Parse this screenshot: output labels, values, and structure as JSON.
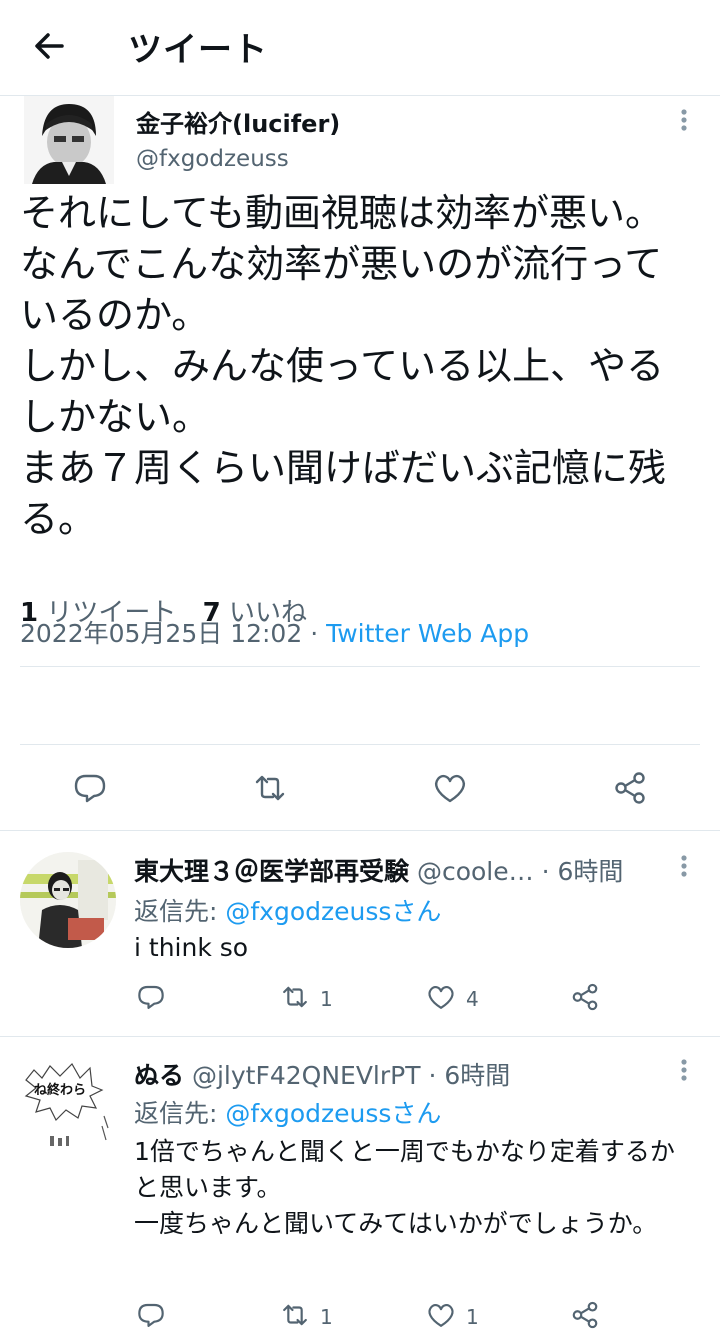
{
  "header": {
    "title": "ツイート"
  },
  "main_tweet": {
    "author_name": "金子裕介(lucifer)",
    "author_handle": "@fxgodzeuss",
    "text": "それにしても動画視聴は効率が悪い。\nなんでこんな効率が悪いのが流行っているのか。\nしかし、みんな使っている以上、やるしかない。\nまあ７周くらい聞けばだいぶ記憶に残る。",
    "timestamp": "2022年05月25日 12:02",
    "separator": " · ",
    "source": "Twitter Web App",
    "retweet_count": "1",
    "retweet_label": "リツイート",
    "like_count": "7",
    "like_label": "いいね"
  },
  "replies": [
    {
      "name": "東大理３＠医学部再受験",
      "handle": "@coole…",
      "time": " · 6時間",
      "reply_to_label": "返信先: ",
      "reply_to_mention": "@fxgodzeussさん",
      "text": "i think so",
      "retweet_count": "1",
      "like_count": "4"
    },
    {
      "name": "ぬる",
      "handle": "@jlytF42QNEVlrPT",
      "time": " · 6時間",
      "reply_to_label": "返信先: ",
      "reply_to_mention": "@fxgodzeussさん",
      "text": "1倍でちゃんと聞くと一周でもかなり定着するかと思います。\n一度ちゃんと聞いてみてはいかがでしょうか。",
      "retweet_count": "1",
      "like_count": "1",
      "avatar_text": "ね終わら"
    }
  ],
  "colors": {
    "accent": "#1d9bf0",
    "text": "#0f1419",
    "muted": "#536471",
    "divider": "#e1e8ed"
  },
  "icons": [
    "back-arrow-icon",
    "more-vertical-icon",
    "reply-icon",
    "retweet-icon",
    "like-icon",
    "share-icon"
  ]
}
